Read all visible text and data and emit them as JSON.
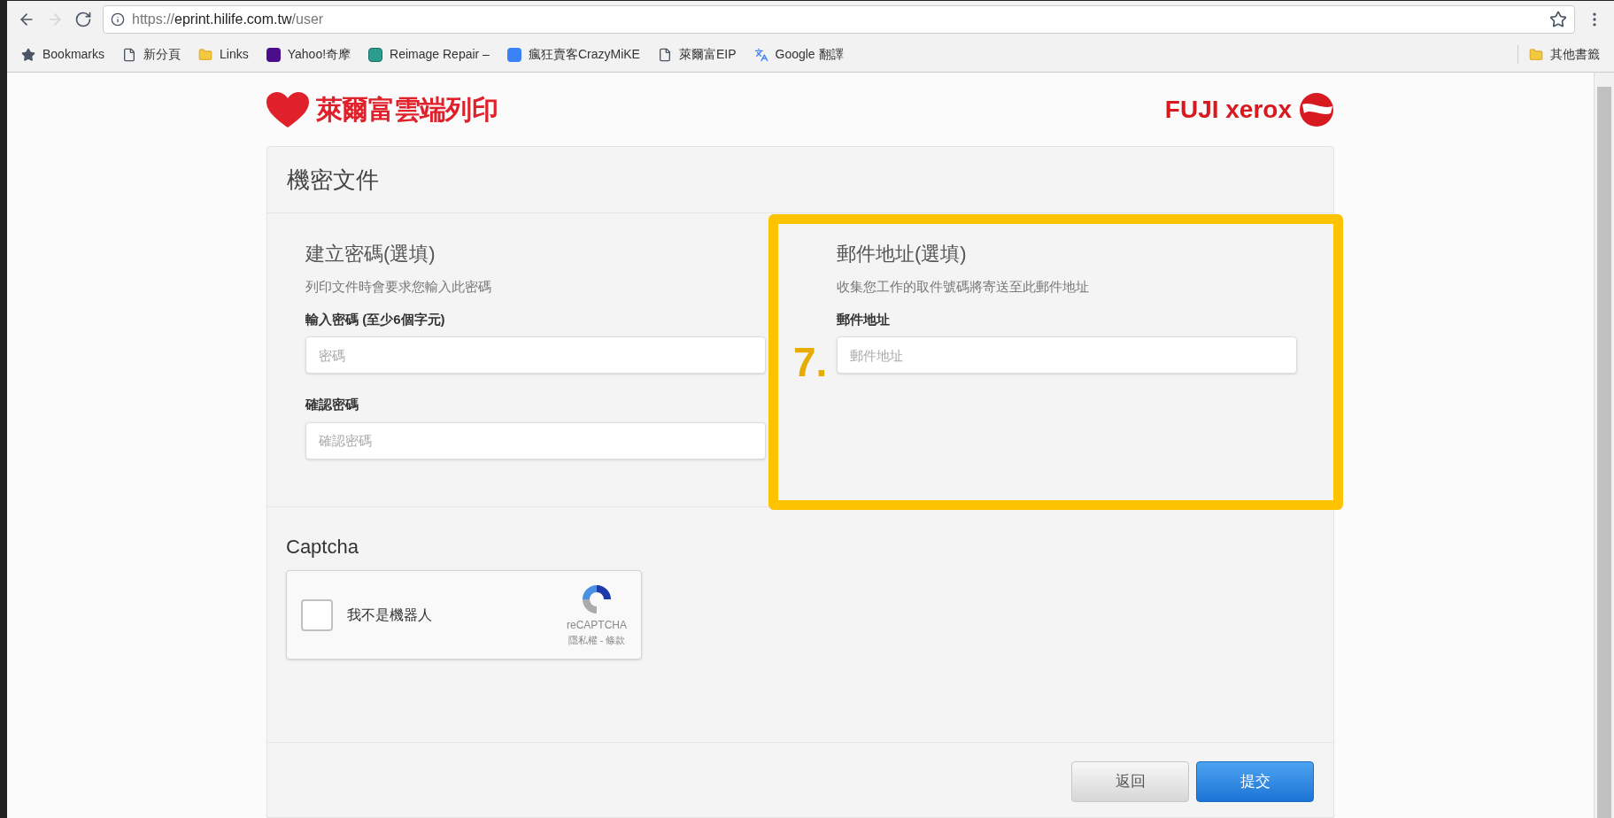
{
  "browser": {
    "url_prefix": "https://",
    "url_host": "eprint.hilife.com.tw",
    "url_path": "/user",
    "bookmarks": [
      {
        "label": "Bookmarks",
        "kind": "star"
      },
      {
        "label": "新分頁",
        "kind": "page"
      },
      {
        "label": "Links",
        "kind": "folder"
      },
      {
        "label": "Yahoo!奇摩",
        "kind": "yahoo"
      },
      {
        "label": "Reimage Repair –",
        "kind": "reimage"
      },
      {
        "label": "瘋狂賣客CrazyMiKE",
        "kind": "site"
      },
      {
        "label": "萊爾富EIP",
        "kind": "page"
      },
      {
        "label": "Google 翻譯",
        "kind": "translate"
      }
    ],
    "other_bookmarks": "其他書籤"
  },
  "header": {
    "logo_text": "萊爾富雲端列印",
    "partner_logo_text": "FUJI xerox"
  },
  "card": {
    "title": "機密文件",
    "sections": [
      {
        "title": "建立密碼(選填)",
        "description": "列印文件時會要求您輸入此密碼",
        "fields": [
          {
            "label": "輸入密碼 (至少6個字元)",
            "placeholder": "密碼"
          },
          {
            "label": "確認密碼",
            "placeholder": "確認密碼"
          }
        ]
      },
      {
        "title": "郵件地址(選填)",
        "description": "收集您工作的取件號碼將寄送至此郵件地址",
        "fields": [
          {
            "label": "郵件地址",
            "placeholder": "郵件地址"
          }
        ]
      }
    ],
    "captcha": {
      "title": "Captcha",
      "checkbox_label": "我不是機器人",
      "checked": false,
      "brand": "reCAPTCHA",
      "links": "隱私權 - 條款"
    },
    "buttons": [
      {
        "label": "返回",
        "kind": "secondary"
      },
      {
        "label": "提交",
        "kind": "primary"
      }
    ]
  },
  "annotation": {
    "label": "7."
  }
}
